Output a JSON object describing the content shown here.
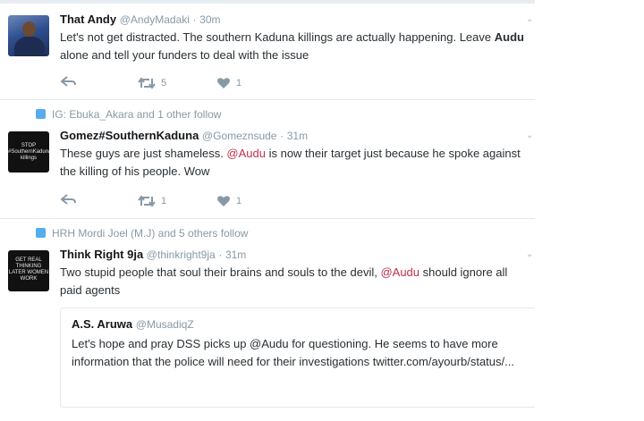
{
  "tweets": [
    {
      "name": "That Andy",
      "handle": "@AndyMadaki",
      "sep": "·",
      "time": "30m",
      "text_parts": [
        "Let's not get distracted. The southern Kaduna killings are actually happening. Leave ",
        "Audu",
        " alone and tell your funders to deal with the issue"
      ],
      "retweets": "5",
      "likes": "1"
    },
    {
      "context": "IG: Ebuka_Akara and 1 other follow",
      "name": "Gomez#SouthernKaduna",
      "handle": "@Gomeznsude",
      "sep": "·",
      "time": "31m",
      "avatar_text": "STOP #SouthernKaduna killings",
      "text_parts": [
        "These guys are just shameless. ",
        "@Audu",
        " is now their target just because he spoke against the killing of his people. Wow"
      ],
      "retweets": "1",
      "likes": "1"
    },
    {
      "context": "HRH Mordi Joel (M.J) and 5 others follow",
      "name": "Think Right 9ja",
      "handle": "@thinkright9ja",
      "sep": "·",
      "time": "31m",
      "avatar_text": "GET REAL THINKING LATER WOMEN WORK",
      "text_parts": [
        "Two stupid people that soul their brains and souls to the devil, ",
        "@Audu",
        " should ignore all paid agents"
      ],
      "quote": {
        "name": "A.S. Aruwa",
        "handle": "@MusadiqZ",
        "text": "Let's hope and pray DSS picks up @Audu for questioning. He seems to have more information that the police will need for their investigations twitter.com/ayourb/status/..."
      }
    }
  ],
  "colors": {
    "mention": "#c0304a",
    "muted": "#8899a6",
    "accent": "#55acee"
  },
  "icons": {
    "reply": "reply-icon",
    "retweet": "retweet-icon",
    "like": "heart-icon",
    "more": "chevron-down-icon",
    "context": "follow-context-icon"
  }
}
